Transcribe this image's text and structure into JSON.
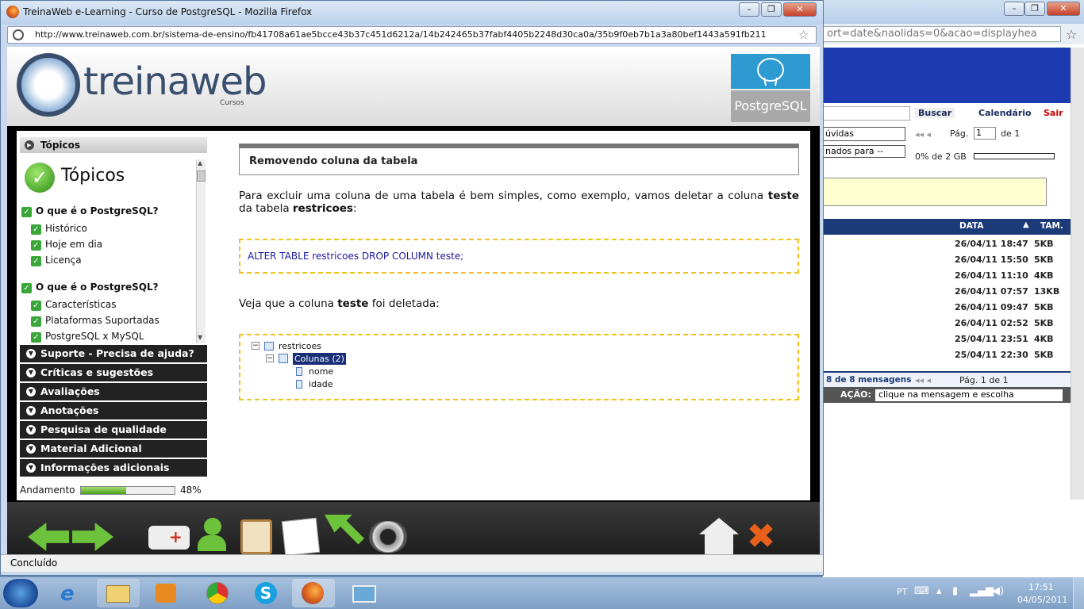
{
  "bg_window": {
    "url_fragment": "ort=date&naolidas=0&acao=displayhea",
    "search_button": "Buscar",
    "calendar_link": "Calendário",
    "exit_link": "Sair",
    "folder_select": "úvidas",
    "filter_select": "nados para --",
    "page_label": "Pág.",
    "page_value": "1",
    "page_of": "de 1",
    "quota": "0% de 2 GB",
    "col_date": "DATA",
    "col_size": "TAM.",
    "rows": [
      {
        "date": "26/04/11 18:47",
        "size": "5KB"
      },
      {
        "date": "26/04/11 15:50",
        "size": "5KB"
      },
      {
        "date": "26/04/11 11:10",
        "size": "4KB"
      },
      {
        "date": "26/04/11 07:57",
        "size": "13KB"
      },
      {
        "date": "26/04/11 09:47",
        "size": "5KB"
      },
      {
        "date": "26/04/11 02:52",
        "size": "5KB"
      },
      {
        "date": "25/04/11 23:51",
        "size": "4KB"
      },
      {
        "date": "25/04/11 22:30",
        "size": "5KB"
      }
    ],
    "msg_count": "8 de 8 mensagens",
    "page_footer": "Pág. 1 de 1",
    "action_label": "AÇÃO:",
    "action_select": "clique na mensagem e escolha"
  },
  "window": {
    "title": "TreinaWeb e-Learning - Curso de PostgreSQL - Mozilla Firefox",
    "url": "http://www.treinaweb.com.br/sistema-de-ensino/fb41708a61ae5bcce43b37c451d6212a/14b242465b37fabf4405b2248d30ca0a/35b9f0eb7b1a3a80bef1443a591fb211",
    "status": "Concluído"
  },
  "header": {
    "logo_text": "treinaweb",
    "logo_sub": "Cursos",
    "course_label": "PostgreSQL"
  },
  "sidebar": {
    "header": "Tópicos",
    "big_title": "Tópicos",
    "sections": [
      {
        "title": "O que é o PostgreSQL?",
        "items": [
          "Histórico",
          "Hoje em dia",
          "Licença"
        ]
      },
      {
        "title": "O que é o PostgreSQL?",
        "items": [
          "Características",
          "Plataformas Suportadas",
          "PostgreSQL x MySQL"
        ]
      }
    ],
    "accordion": [
      "Suporte - Precisa de ajuda?",
      "Críticas e sugestões",
      "Avaliações",
      "Anotações",
      "Pesquisa de qualidade",
      "Material Adicional",
      "Informações adicionais"
    ],
    "progress_label": "Andamento",
    "progress_value": 48,
    "progress_text": "48%"
  },
  "lesson": {
    "title": "Removendo coluna da tabela",
    "para1_a": "Para excluir uma coluna de uma tabela é bem simples, como exemplo, vamos deletar a coluna ",
    "para1_b": "teste",
    "para1_c": " da tabela ",
    "para1_d": "restricoes",
    "para1_e": ":",
    "code": "ALTER TABLE restricoes DROP COLUMN teste;",
    "para2_a": "Veja que a coluna ",
    "para2_b": "teste",
    "para2_c": " foi deletada:",
    "tree": {
      "table": "restricoes",
      "columns_node": "Colunas (2)",
      "columns": [
        "nome",
        "idade"
      ]
    }
  },
  "taskbar": {
    "lang": "PT",
    "time": "17:51",
    "date": "04/05/2011"
  }
}
